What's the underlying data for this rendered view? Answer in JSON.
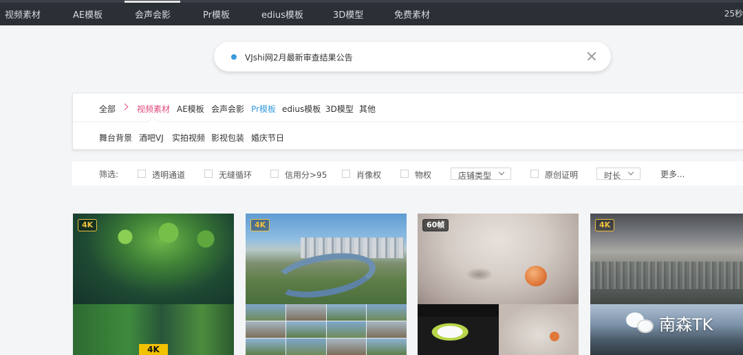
{
  "topnav": {
    "items": [
      "视频素材",
      "AE模板",
      "会声会影",
      "Pr模板",
      "edius模板",
      "3D模型",
      "免费素材"
    ],
    "right_text": "25秒"
  },
  "notice": {
    "text": "VJshi网2月最新审查结果公告"
  },
  "categories": {
    "root": "全部",
    "items": [
      "视频素材",
      "AE模板",
      "会声会影",
      "Pr模板",
      "edius模板",
      "3D模型",
      "其他"
    ],
    "sub_items": [
      "舞台背景",
      "酒吧VJ",
      "实拍视频",
      "影视包装",
      "婚庆节日"
    ]
  },
  "filter": {
    "label": "筛选:",
    "checks": [
      "透明通道",
      "无缝循环",
      "信用分>95",
      "肖像权",
      "物权"
    ],
    "shop_type": "店铺类型",
    "original_proof": "原创证明",
    "duration": "时长",
    "more": "更多..."
  },
  "cards": [
    {
      "badge": "4K",
      "overlay_logo": "4K"
    },
    {
      "badge": "4K"
    },
    {
      "badge": "60帧"
    },
    {
      "badge": "4K"
    }
  ],
  "watermark": {
    "text": "南森TK"
  },
  "colors": {
    "nav_bg": "#2b2f36",
    "accent_pink": "#e0497c",
    "accent_blue": "#3a9bdc",
    "badge_gold": "#f0c040"
  }
}
